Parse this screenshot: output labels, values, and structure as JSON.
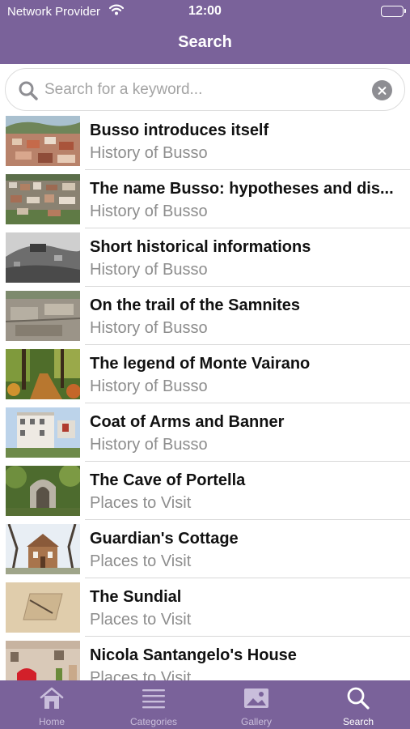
{
  "status_bar": {
    "carrier": "Network Provider",
    "time": "12:00"
  },
  "nav": {
    "title": "Search"
  },
  "search": {
    "placeholder": "Search for a keyword...",
    "value": ""
  },
  "results": [
    {
      "title": "Busso introduces itself",
      "category": "History of Busso",
      "thumb": "town-aerial-sunset"
    },
    {
      "title": "The name Busso: hypotheses and dis...",
      "category": "History of Busso",
      "thumb": "town-aerial"
    },
    {
      "title": "Short historical informations",
      "category": "History of Busso",
      "thumb": "historic-bw-photo"
    },
    {
      "title": "On the trail of the Samnites",
      "category": "History of Busso",
      "thumb": "excavation-site"
    },
    {
      "title": "The legend of Monte Vairano",
      "category": "History of Busso",
      "thumb": "forest-path"
    },
    {
      "title": "Coat of Arms and Banner",
      "category": "History of Busso",
      "thumb": "town-hall"
    },
    {
      "title": "The Cave of Portella",
      "category": "Places to Visit",
      "thumb": "stone-arch"
    },
    {
      "title": "Guardian's Cottage",
      "category": "Places to Visit",
      "thumb": "brick-cottage"
    },
    {
      "title": "The Sundial",
      "category": "Places to Visit",
      "thumb": "sundial-stone"
    },
    {
      "title": "Nicola Santangelo's House",
      "category": "Places to Visit",
      "thumb": "red-door-house"
    }
  ],
  "tabs": [
    {
      "label": "Home",
      "icon": "home-icon",
      "active": false
    },
    {
      "label": "Categories",
      "icon": "list-icon",
      "active": false
    },
    {
      "label": "Gallery",
      "icon": "photo-icon",
      "active": false
    },
    {
      "label": "Search",
      "icon": "search-icon",
      "active": true
    }
  ],
  "colors": {
    "brand": "#7a629a",
    "tab_inactive": "#c9bedb",
    "subtitle": "#8d8d8d"
  }
}
